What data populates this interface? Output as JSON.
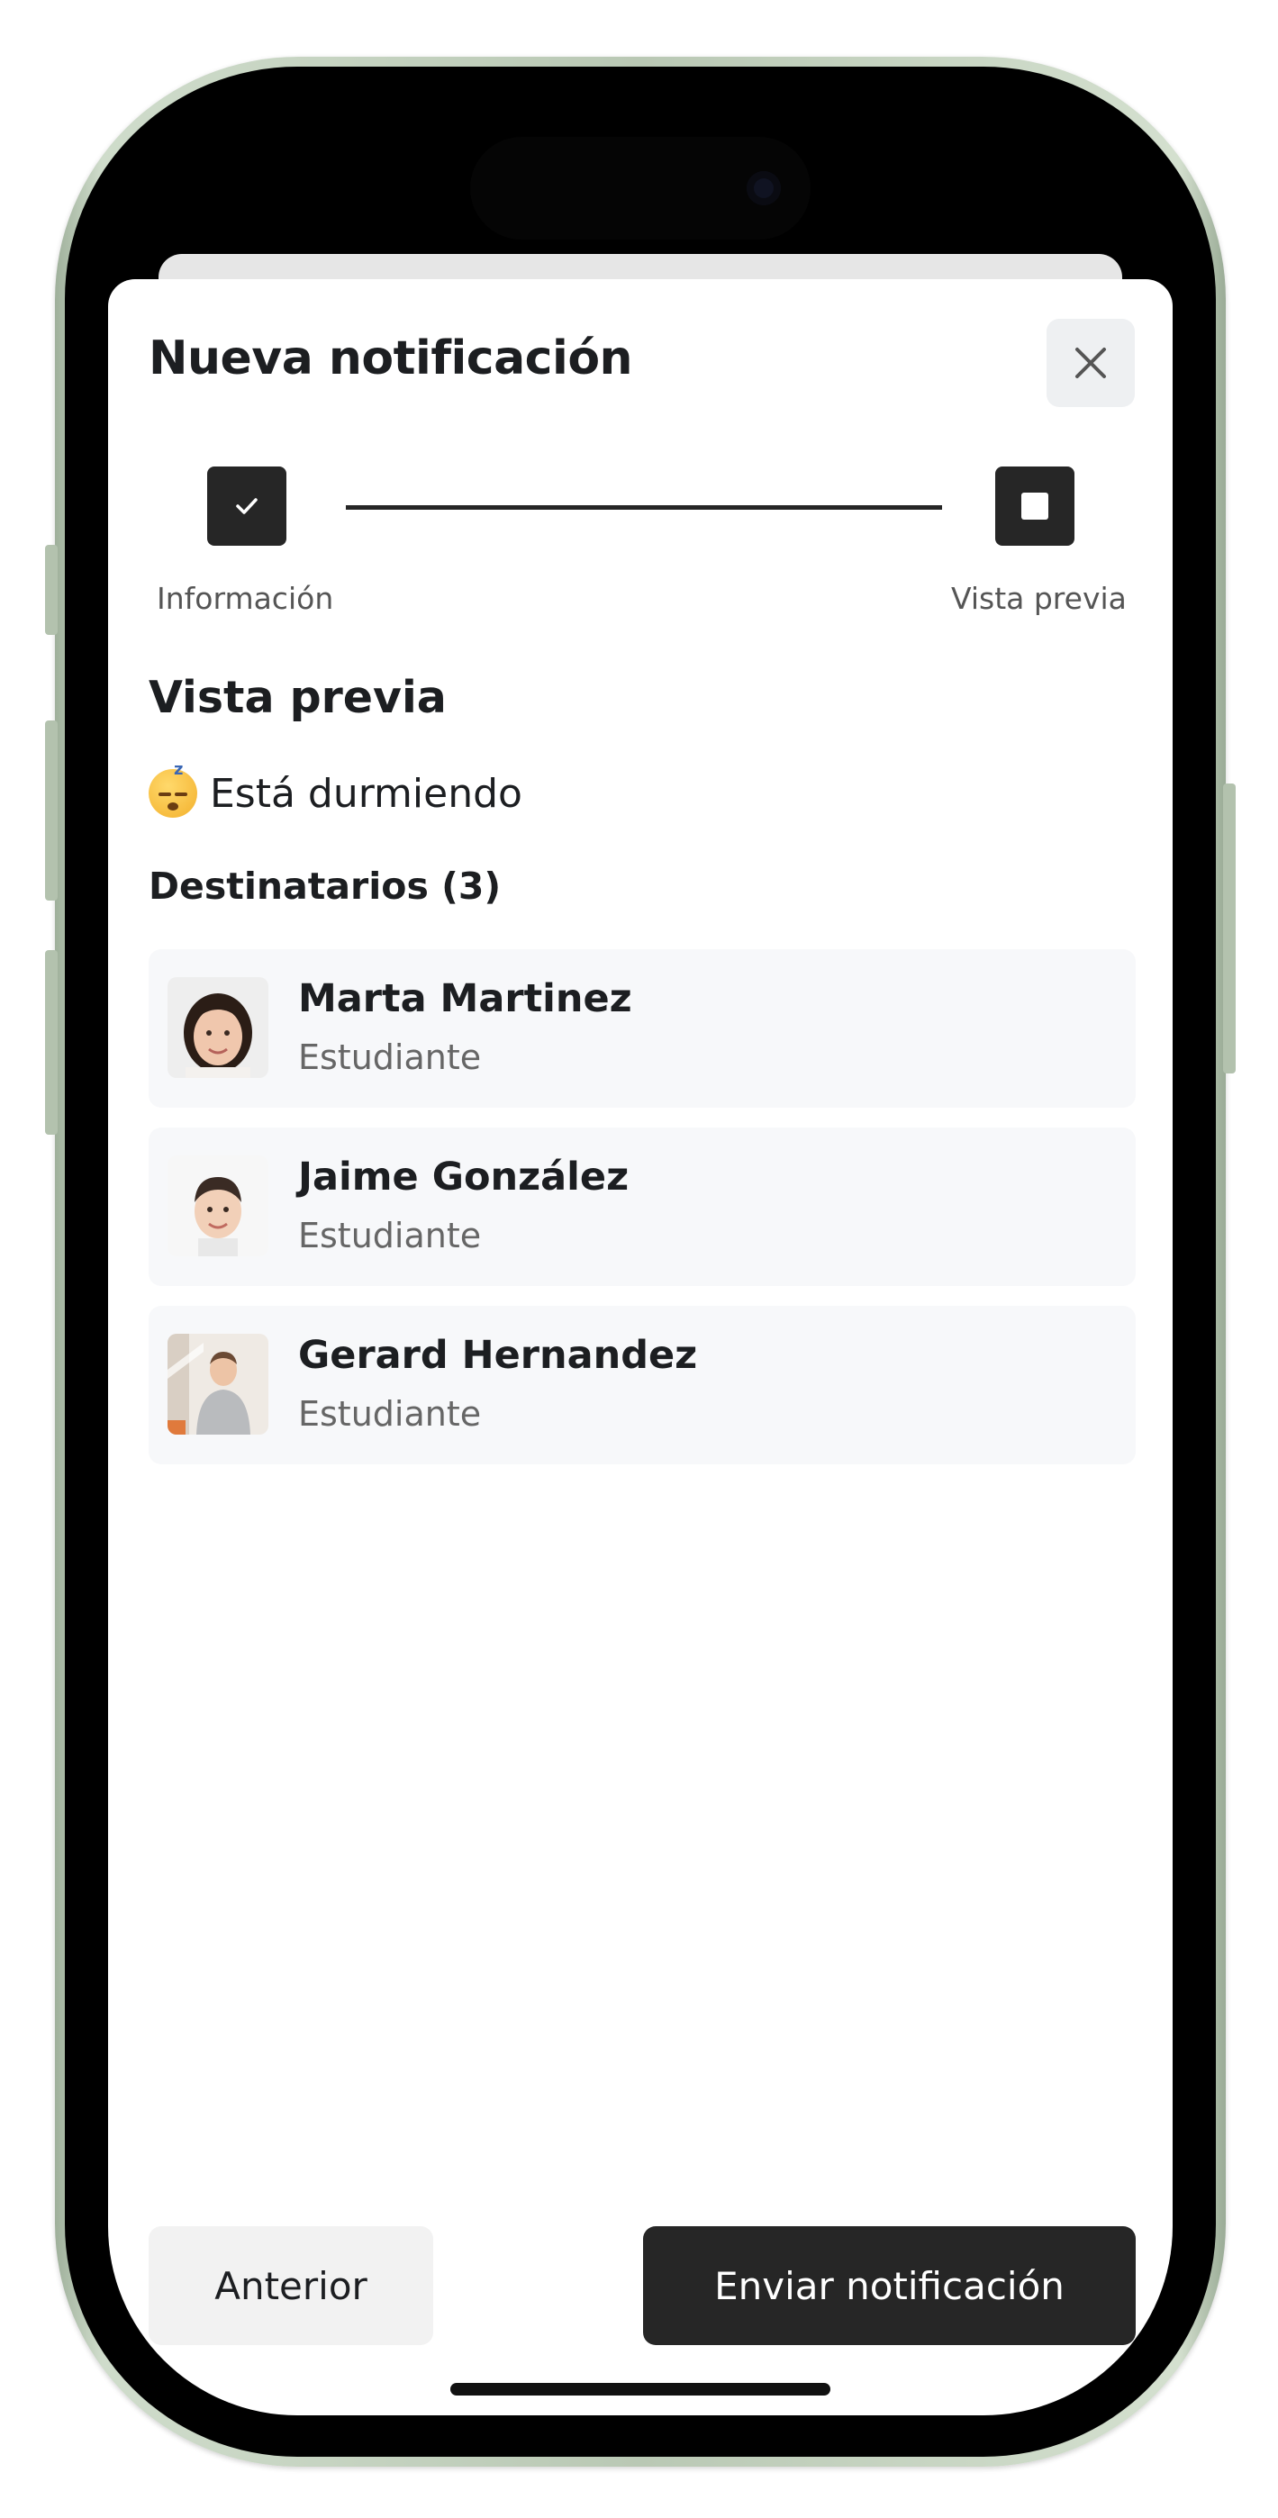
{
  "modal": {
    "title": "Nueva notificación"
  },
  "stepper": {
    "steps": [
      {
        "label": "Información",
        "state": "completed",
        "icon": "check-icon"
      },
      {
        "label": "Vista previa",
        "state": "current",
        "icon": "square-icon"
      }
    ]
  },
  "preview": {
    "heading": "Vista previa",
    "emoji": "sleeping-face",
    "message": "Está durmiendo"
  },
  "recipients": {
    "heading": "Destinatarios (3)",
    "items": [
      {
        "name": "Marta Martinez",
        "role": "Estudiante"
      },
      {
        "name": "Jaime González",
        "role": "Estudiante"
      },
      {
        "name": "Gerard Hernandez",
        "role": "Estudiante"
      }
    ]
  },
  "actions": {
    "previous_label": "Anterior",
    "send_label": "Enviar notificación"
  },
  "colors": {
    "primary": "#262626",
    "card_bg": "#f7f8fa",
    "frame": "#c5d3c0"
  }
}
